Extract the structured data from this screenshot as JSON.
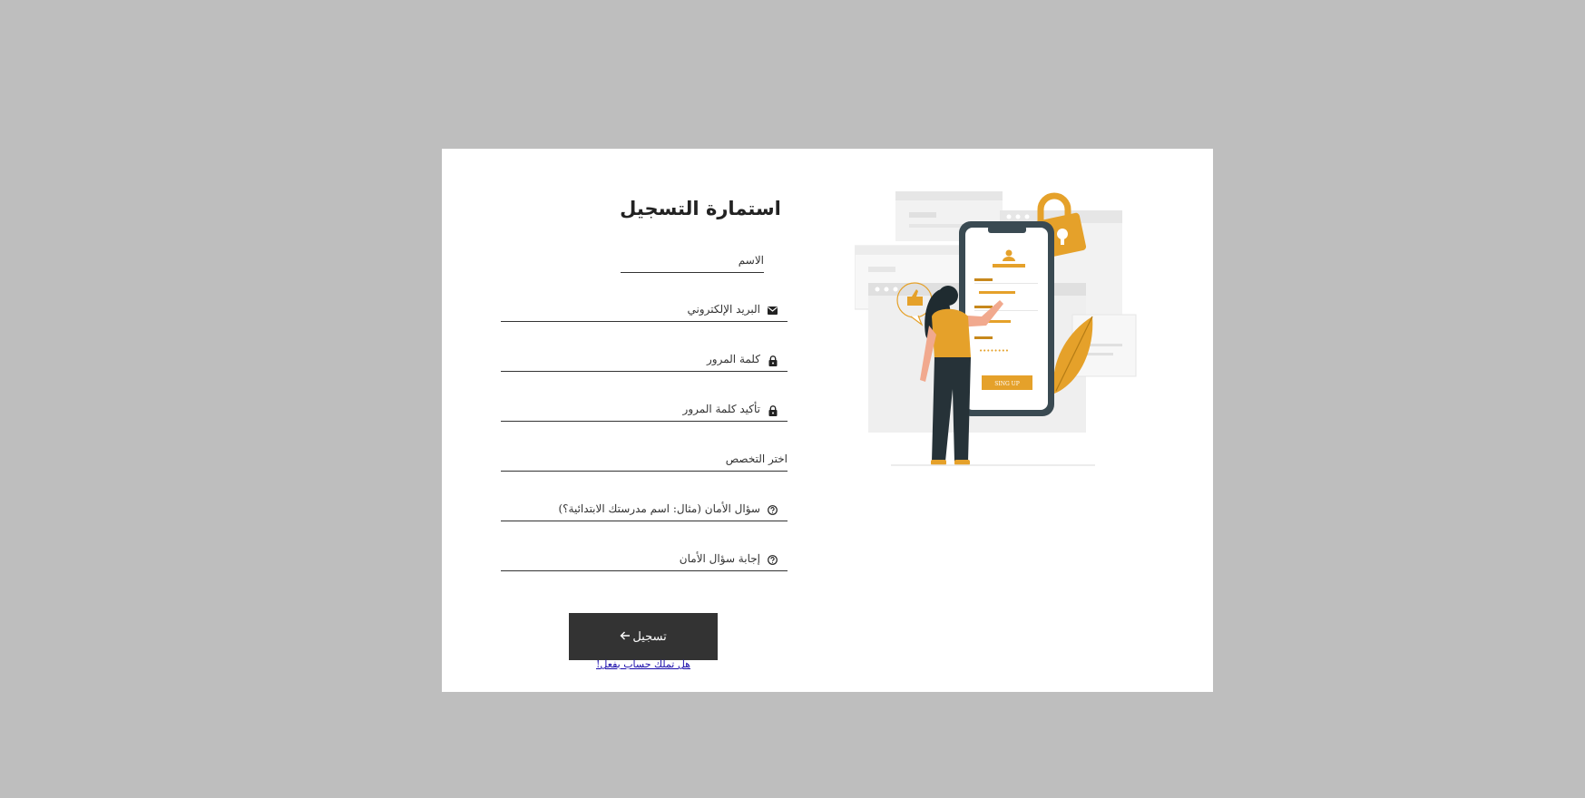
{
  "form": {
    "title": "استمارة التسجيل",
    "fields": [
      {
        "label": "الاسم",
        "icon": ""
      },
      {
        "label": "البريد الإلكتروني",
        "icon": "envelope-icon"
      },
      {
        "label": "كلمة المرور",
        "icon": "lock-icon"
      },
      {
        "label": "تأكيد كلمة المرور",
        "icon": "lock-icon"
      },
      {
        "label": "اختر التخصص",
        "icon": ""
      },
      {
        "label": "سؤال الأمان (مثال: اسم مدرستك الابتدائية؟)",
        "icon": "question-circle-icon"
      },
      {
        "label": "إجابة سؤال الأمان",
        "icon": "question-circle-icon"
      }
    ],
    "submit_label": "تسجيل",
    "submit_icon": "arrow-left-icon",
    "login_link": "هل تملك حساب بفعل!"
  },
  "illustration": {
    "button_text": "SING UP",
    "password_dots": "••••••••",
    "accent_color": "#e5a12a"
  },
  "colors": {
    "background": "#bebebe",
    "card": "#ffffff",
    "button": "#333333",
    "accent": "#e5a12a"
  }
}
